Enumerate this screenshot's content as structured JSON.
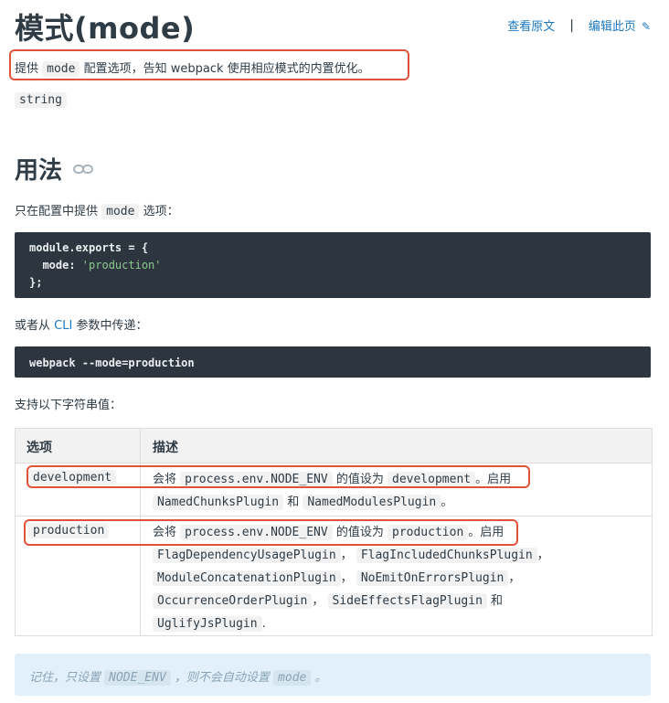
{
  "page": {
    "title": "模式(mode)",
    "view_source": "查看原文",
    "separator": "|",
    "edit_page": "编辑此页",
    "intro": {
      "before": "提供",
      "code": "mode",
      "after": "配置选项，告知 webpack 使用相应模式的内置优化。"
    },
    "type": "string"
  },
  "usage": {
    "heading": "用法",
    "p1": {
      "before": "只在配置中提供",
      "code": "mode",
      "after": "选项："
    },
    "code1": {
      "line1": "module.exports = {",
      "line2_key": "  mode: ",
      "line2_val": "'production'",
      "line3": "};"
    },
    "p2": {
      "before": "或者从",
      "link": "CLI",
      "after": "参数中传递："
    },
    "code2": "webpack --mode=production",
    "p3": "支持以下字符串值："
  },
  "table": {
    "headers": [
      "选项",
      "描述"
    ],
    "rows": [
      {
        "option": "development",
        "desc_pre": "会将",
        "desc_code1": "process.env.NODE_ENV",
        "desc_mid": "的值设为",
        "desc_code2": "development",
        "desc_post": "。启用",
        "plugin1": "NamedChunksPlugin",
        "and": "和",
        "plugin2": "NamedModulesPlugin",
        "end": "。"
      },
      {
        "option": "production",
        "desc_pre": "会将",
        "desc_code1": "process.env.NODE_ENV",
        "desc_mid": "的值设为",
        "desc_code2": "production",
        "desc_post": "。启用",
        "plugins": [
          "FlagDependencyUsagePlugin",
          "FlagIncludedChunksPlugin",
          "ModuleConcatenationPlugin",
          "NoEmitOnErrorsPlugin",
          "OccurrenceOrderPlugin",
          "SideEffectsFlagPlugin",
          "UglifyJsPlugin"
        ],
        "comma": "，",
        "and": "和",
        "end": "."
      }
    ]
  },
  "note": {
    "before": "记住，只设置",
    "code": "NODE_ENV",
    "mid": "，则不会自动设置",
    "code2": "mode",
    "after": "。"
  },
  "colors": {
    "accent": "#1d78c1",
    "highlight": "#e0533a",
    "code_bg": "#2d353e",
    "note_bg": "#e1f0fb"
  },
  "icons": {
    "edit": "pencil-icon",
    "anchor": "link-icon"
  }
}
